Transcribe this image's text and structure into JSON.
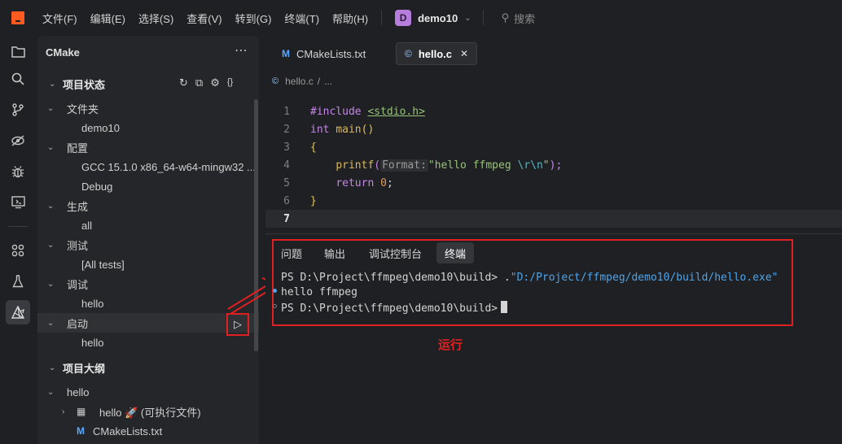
{
  "menubar": {
    "items": [
      "文件(F)",
      "编辑(E)",
      "选择(S)",
      "查看(V)",
      "转到(G)",
      "终端(T)",
      "帮助(H)"
    ],
    "project_initial": "D",
    "project_name": "demo10",
    "search_placeholder": "搜索"
  },
  "activitybar": {
    "icons": [
      "explorer-icon",
      "search-icon",
      "source-control-icon",
      "run-debug-icon",
      "debug-bug-icon",
      "remote-monitor-icon",
      "extensions-icon",
      "testing-icon",
      "cmake-icon"
    ]
  },
  "sidebar": {
    "title": "CMake",
    "project_status": {
      "label": "项目状态",
      "groups": [
        {
          "label": "文件夹",
          "child": "demo10"
        },
        {
          "label": "配置",
          "child": "GCC 15.1.0 x86_64-w64-mingw32 ..."
        },
        {
          "child": "Debug"
        },
        {
          "label": "生成",
          "child": "all"
        },
        {
          "label": "测试",
          "child": "[All tests]"
        },
        {
          "label": "调试",
          "child": "hello"
        },
        {
          "label": "启动",
          "child": "hello"
        }
      ]
    },
    "project_outline": {
      "label": "项目大纲",
      "root": "hello",
      "target": "hello",
      "target_emoji": "🚀",
      "target_type": "(可执行文件)",
      "file": "CMakeLists.txt"
    }
  },
  "editor": {
    "tabs": [
      {
        "label": "CMakeLists.txt",
        "icon": "M"
      },
      {
        "label": "hello.c",
        "icon": "©"
      }
    ],
    "breadcrumb": {
      "file": "hello.c",
      "rest": "..."
    },
    "code": {
      "line_numbers": [
        "1",
        "2",
        "3",
        "4",
        "5",
        "6",
        "7"
      ],
      "l1_directive": "#include",
      "l1_header": "<stdio.h>",
      "l2_type": "int",
      "l2_func": "main",
      "l2_parens": "()",
      "l3": "{",
      "l4_func": "printf",
      "l4_open": "(",
      "l4_hint": "Format:",
      "l4_str_a": "\"hello ffmpeg ",
      "l4_esc1": "\\r",
      "l4_esc2": "\\n",
      "l4_str_b": "\"",
      "l4_close": ");",
      "l5_kw": "return",
      "l5_num": "0",
      "l5_semi": ";",
      "l6": "}"
    }
  },
  "panel": {
    "tabs": [
      "问题",
      "输出",
      "调试控制台",
      "终端"
    ],
    "terminal": {
      "line1_prompt": "PS D:\\Project\\ffmpeg\\demo10\\build> .",
      "line1_path": "\"D:/Project/ffmpeg/demo10/build/hello.exe\"",
      "line2": "hello ffmpeg",
      "line3_prompt": "PS D:\\Project\\ffmpeg\\demo10\\build>"
    }
  },
  "annotation": {
    "run_label": "运行",
    "color": "#e02020"
  },
  "colors": {
    "accent_logo": "#ff5a1f",
    "project_badge": "#b77ddc",
    "highlight_red": "#e02020"
  }
}
